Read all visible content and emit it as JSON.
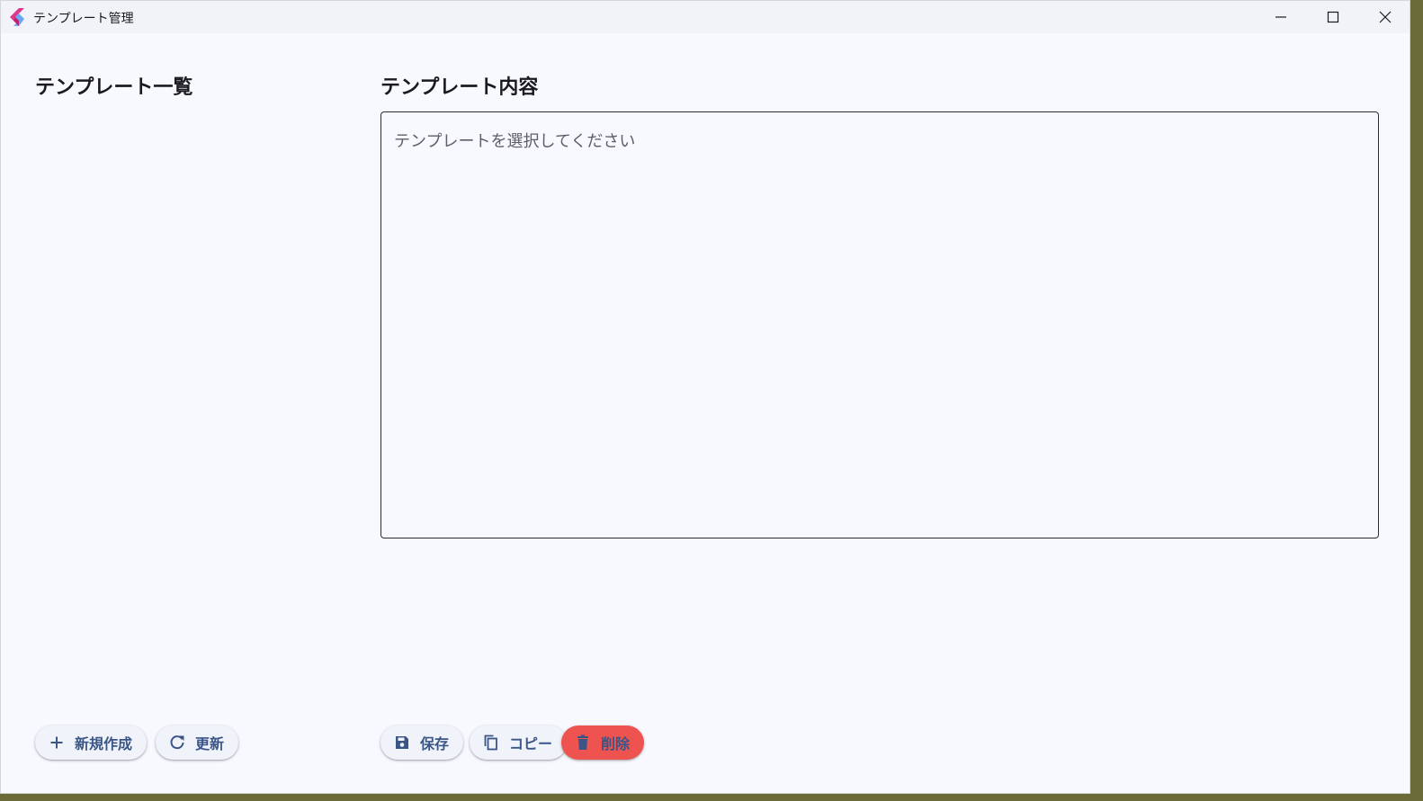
{
  "window": {
    "title": "テンプレート管理",
    "app_icon": "flutter-like-logo-icon",
    "controls": [
      "minimize-icon",
      "maximize-icon",
      "close-icon"
    ]
  },
  "left_panel": {
    "title": "テンプレート一覧",
    "items": [],
    "buttons": {
      "new_label": "新規作成",
      "new_icon": "plus-icon",
      "refresh_label": "更新",
      "refresh_icon": "refresh-icon"
    }
  },
  "right_panel": {
    "title": "テンプレート内容",
    "editor": {
      "value": "",
      "placeholder": "テンプレートを選択してください"
    },
    "buttons": {
      "save_label": "保存",
      "save_icon": "save-icon",
      "copy_label": "コピー",
      "copy_icon": "copy-icon",
      "delete_label": "削除",
      "delete_icon": "trash-icon"
    }
  },
  "colors": {
    "background": "#f8f9ff",
    "button_text": "#3a5586",
    "delete_button": "#ef5350",
    "border": "#2b2d33"
  }
}
